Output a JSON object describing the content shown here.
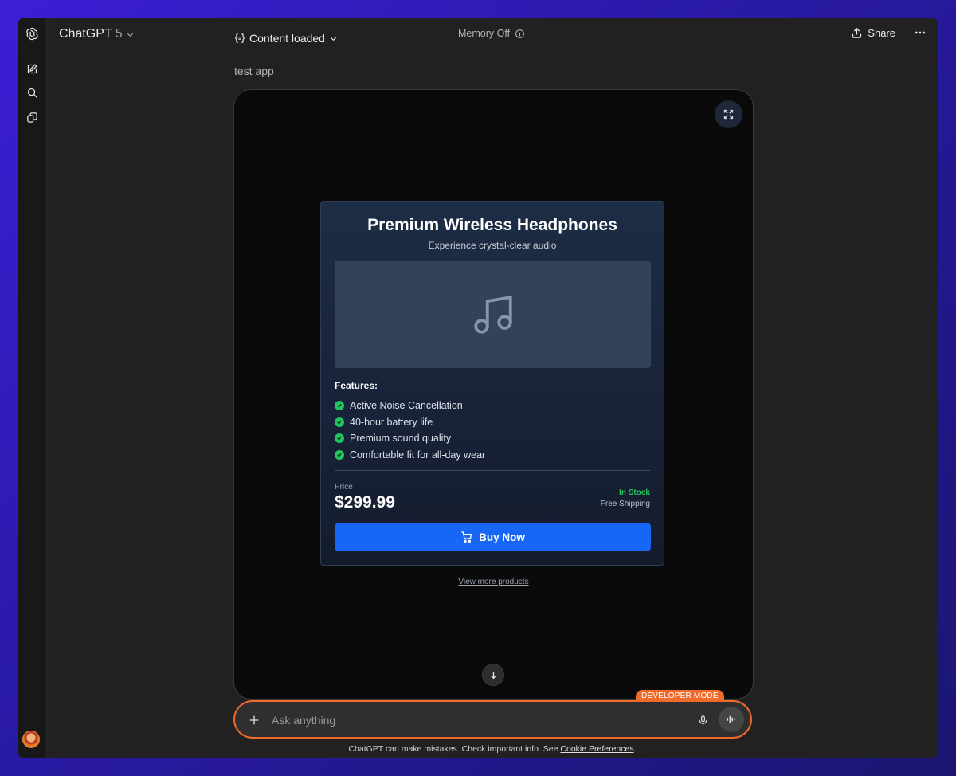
{
  "header": {
    "model_name": "ChatGPT",
    "model_version": "5",
    "status": "Content loaded",
    "memory": "Memory Off",
    "share_label": "Share"
  },
  "conversation": {
    "user_message": "test app"
  },
  "product_card": {
    "title": "Premium Wireless Headphones",
    "subtitle": "Experience crystal-clear audio",
    "image_icon": "music-note-icon",
    "features_label": "Features:",
    "features": [
      "Active Noise Cancellation",
      "40-hour battery life",
      "Premium sound quality",
      "Comfortable fit for all-day wear"
    ],
    "price_label": "Price",
    "price": "$299.99",
    "stock_status": "In Stock",
    "shipping": "Free Shipping",
    "buy_label": "Buy Now",
    "view_more": "View more products"
  },
  "composer": {
    "badge": "DEVELOPER MODE",
    "placeholder": "Ask anything"
  },
  "footer": {
    "disclaimer": "ChatGPT can make mistakes. Check important info. See",
    "link": "Cookie Preferences",
    "end": "."
  },
  "colors": {
    "accent": "#1766f5",
    "in_stock": "#22c55e",
    "developer_mode": "#f06a2b"
  }
}
